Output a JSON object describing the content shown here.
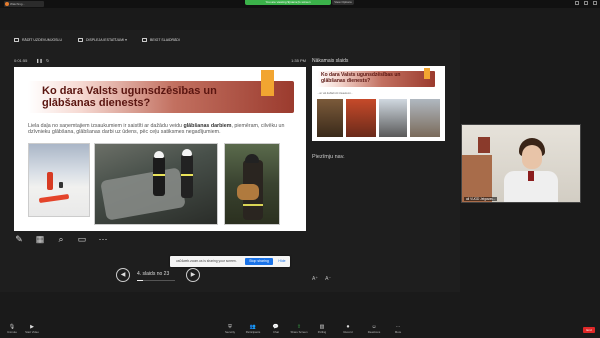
{
  "browser_tab": {
    "label": "Watching..."
  },
  "share_banner": {
    "text": "You are viewing ${name}'s screen",
    "view_options": "View Options"
  },
  "toolbar": {
    "show_taskbar": "RĀDĪT UZDEVUMJOSLU",
    "display_settings": "DISPLEJA IESTATĪJUMI ▾",
    "end_slideshow": "BEIGT SLAIDRĀDI"
  },
  "presenter": {
    "timer": "0:01:55",
    "clock": "1:35 PM",
    "slide_nav": "4. slaids no 23"
  },
  "slide": {
    "title": "Ko dara Valsts ugunsdzēsības un glābšanas dienests?",
    "body_before": "Liela daļa no saņemtajiem izsaukumiem ir saistīti ar dažādu veidu ",
    "body_bold": "glābšanas darbiem",
    "body_after": ", piemēram, cilvēku un dzīvnieku glābšana, glābšanas darbi uz ūdens, pēc ceļu satiksmes negadījumiem."
  },
  "next_slide": {
    "label": "Nākamais slaids",
    "title": "Ko dara Valsts ugunsdzēsības un glābšanas dienests?",
    "subtitle": "...un vēl dažādi citi izsaukumi..."
  },
  "notes": {
    "text": "Piezīmju nav."
  },
  "share_notice": {
    "text": "us04web.zoom.us is sharing your screen.",
    "stop_label": "Stop sharing",
    "hide_label": "Hide"
  },
  "video": {
    "participant": "all VUGD Jelgavas..."
  },
  "bottom_toolbar": {
    "items": [
      {
        "label": "Unmute",
        "icon": "mic-icon"
      },
      {
        "label": "Start Video",
        "icon": "video-icon"
      },
      {
        "label": "Security",
        "icon": "shield-icon"
      },
      {
        "label": "Participants",
        "icon": "participants-icon"
      },
      {
        "label": "Chat",
        "icon": "chat-icon"
      },
      {
        "label": "Share Screen",
        "icon": "share-icon"
      },
      {
        "label": "Polling",
        "icon": "poll-icon"
      },
      {
        "label": "Record",
        "icon": "record-icon"
      },
      {
        "label": "Reactions",
        "icon": "reaction-icon"
      },
      {
        "label": "More",
        "icon": "more-icon"
      }
    ],
    "leave": "End"
  },
  "colors": {
    "accent_green": "#3bb24a",
    "slide_title_dark": "#5a1510",
    "accent_orange": "#f2a531",
    "stop_blue": "#1a73e8"
  }
}
